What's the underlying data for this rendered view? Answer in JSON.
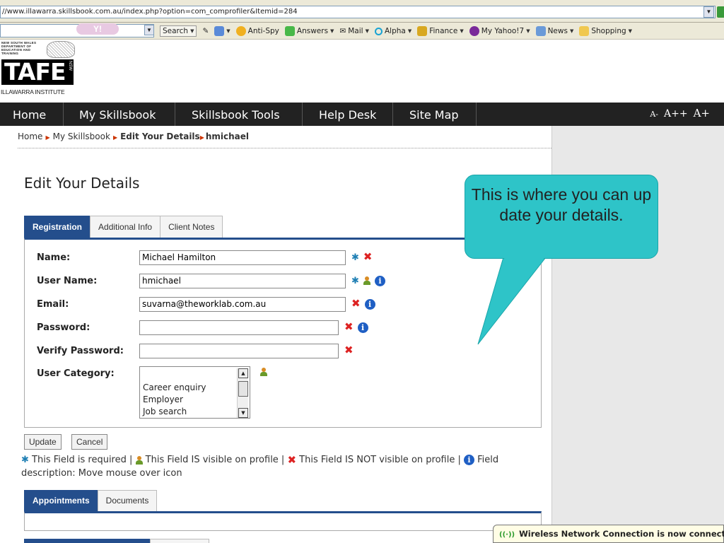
{
  "browser": {
    "url": "//www.illawarra.skillsbook.com.au/index.php?option=com_comprofiler&Itemid=284"
  },
  "yahoo_toolbar": {
    "logo": "Y!",
    "search_label": "Search",
    "anti_spy": "Anti-Spy",
    "answers": "Answers",
    "mail": "Mail",
    "alpha": "Alpha",
    "finance": "Finance",
    "my_yahoo": "My Yahoo!7",
    "news": "News",
    "shopping": "Shopping"
  },
  "branding": {
    "department": "NEW SOUTH WALES DEPARTMENT OF EDUCATION AND TRAINING",
    "tafe": "TAFE",
    "nsw": "NSW",
    "institute": "ILLAWARRA INSTITUTE"
  },
  "nav": {
    "items": [
      "Home",
      "My Skillsbook",
      "Skillsbook Tools",
      "Help Desk",
      "Site Map"
    ],
    "font_sizes": [
      "A-",
      "A++",
      "A+"
    ]
  },
  "breadcrumb": {
    "home": "Home",
    "my_skillsbook": "My Skillsbook",
    "edit": "Edit Your Details",
    "user": "hmichael"
  },
  "page_title": "Edit Your Details",
  "tabs": [
    "Registration",
    "Additional Info",
    "Client Notes"
  ],
  "form": {
    "name_label": "Name:",
    "name_value": "Michael Hamilton",
    "username_label": "User Name:",
    "username_value": "hmichael",
    "email_label": "Email:",
    "email_value": "suvarna@theworklab.com.au",
    "password_label": "Password:",
    "verify_label": "Verify Password:",
    "category_label": "User Category:",
    "category_options": [
      "Career enquiry",
      "Employer",
      "Job search"
    ]
  },
  "buttons": {
    "update": "Update",
    "cancel": "Cancel"
  },
  "legend": {
    "required": "This Field is required |",
    "visible": "This Field IS visible on profile |",
    "not_visible": "This Field IS NOT visible on profile |",
    "description": "Field description: Move mouse over icon"
  },
  "bottom_tabs": [
    "Appointments",
    "Documents"
  ],
  "callout": {
    "text": "This is where you can up date your details."
  },
  "notification": {
    "text": "Wireless Network Connection is now connected"
  },
  "colors": {
    "nav_bg": "#222222",
    "tab_active": "#244e8c",
    "callout": "#2ec4c8"
  }
}
